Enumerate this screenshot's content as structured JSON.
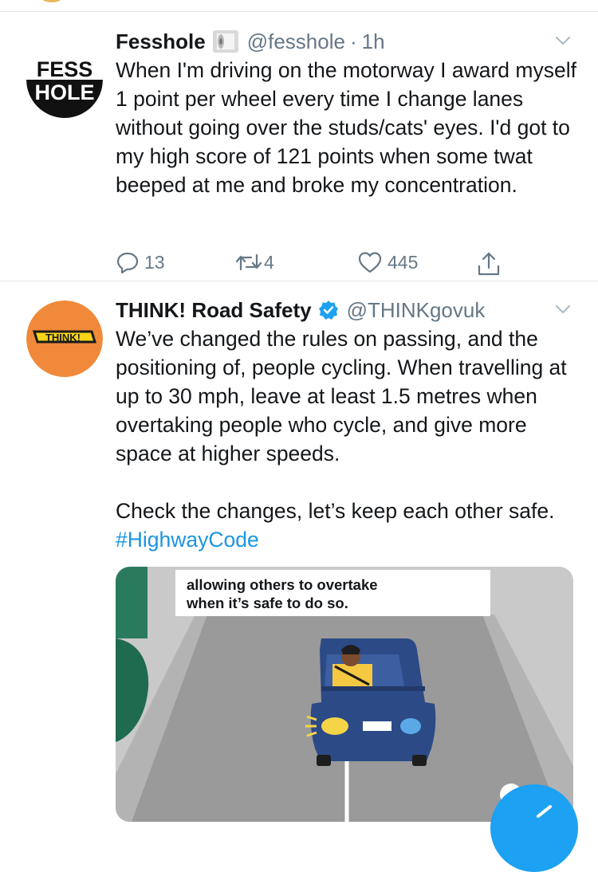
{
  "tweets": [
    {
      "name": "Fesshole",
      "handle": "@fesshole",
      "time": "1h",
      "avatar_text": [
        "FESS",
        "HOLE"
      ],
      "text": "When I'm driving on the motorway I award myself 1 point per wheel every time I change lanes without going over the studs/cats' eyes. I'd got to my high score of 121 points when some twat beeped at me and broke my concentration.",
      "replies": "13",
      "retweets": "4",
      "likes": "445",
      "icons": [
        "toilet-roll-icon",
        "chevron-down-icon",
        "reply-icon",
        "retweet-icon",
        "like-icon",
        "share-icon"
      ]
    },
    {
      "name": "THINK! Road Safety",
      "handle": "@THINKgovuk",
      "avatar_text": "THINK!",
      "text": "We’ve changed the rules on passing, and the positioning of, people cycling. When travelling at up to 30 mph, leave at least 1.5 metres when overtaking people who cycle, and give more space at higher speeds.\n\nCheck the changes, let’s keep each other safe. ",
      "hashtag": "#HighwayCode",
      "media_caption": "allowing others to overtake\nwhen it’s safe to do so.",
      "icons": [
        "verified-badge-icon",
        "chevron-down-icon"
      ]
    }
  ],
  "colors": {
    "text": "#14171a",
    "secondary": "#657786",
    "link": "#1b95e0",
    "think_orange": "#f08a3a",
    "car_blue": "#2c4a86",
    "compose_button": "#1da1f2"
  }
}
